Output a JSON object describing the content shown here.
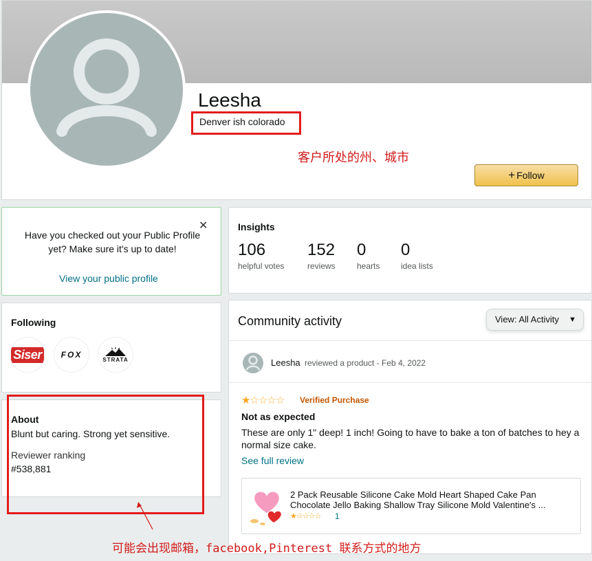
{
  "profile": {
    "name": "Leesha",
    "location": "Denver ish colorado",
    "follow_label": "Follow"
  },
  "annotations": {
    "location_note": "客户所处的州、城市",
    "about_note": "可能会出现邮箱，facebook,Pinterest 联系方式的地方",
    "highlight_color": "#e31b1b"
  },
  "notice": {
    "text": "Have you checked out your Public Profile yet? Make sure it's up to date!",
    "link": "View your public profile",
    "close_icon": "close-icon"
  },
  "following": {
    "title": "Following",
    "brands": [
      {
        "name": "Siser"
      },
      {
        "name": "FOX"
      },
      {
        "name": "STRATA"
      }
    ]
  },
  "about": {
    "title": "About",
    "text": "Blunt but caring. Strong yet sensitive.",
    "ranking_label": "Reviewer ranking",
    "ranking_value": "#538,881"
  },
  "insights": {
    "title": "Insights",
    "stats": [
      {
        "value": "106",
        "label": "helpful votes"
      },
      {
        "value": "152",
        "label": "reviews"
      },
      {
        "value": "0",
        "label": "hearts"
      },
      {
        "value": "0",
        "label": "idea lists"
      }
    ]
  },
  "activity": {
    "title": "Community activity",
    "view_label": "View:",
    "view_value": "All Activity",
    "item": {
      "user": "Leesha",
      "meta": "reviewed a product - Feb 4, 2022",
      "rating": 1,
      "rating_max": 5,
      "verified": "Verified Purchase",
      "review_title": "Not as expected",
      "review_body": "These are only 1\" deep! 1 inch! Going to have to bake a ton of batches to hey a normal size cake.",
      "full_review_link": "See full review",
      "product_title": "2 Pack Reusable Silicone Cake Mold Heart Shaped Cake Pan Chocolate Jello Baking Shallow Tray Silicone Mold Valentine's ...",
      "product_rating": 1,
      "product_rating_count": "1"
    }
  }
}
